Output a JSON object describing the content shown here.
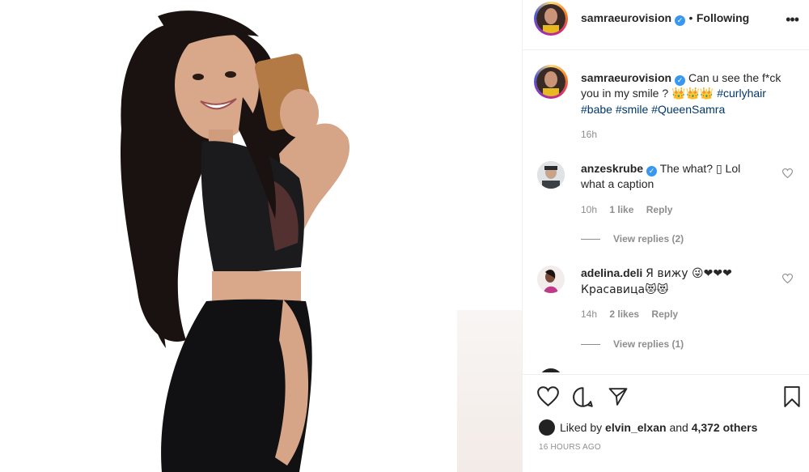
{
  "post": {
    "username": "samraeurovision",
    "verified_mark": "✓",
    "separator": "•",
    "follow_status": "Following",
    "more_icon": "•••"
  },
  "caption": {
    "username": "samraeurovision",
    "text": "Can u see the f*ck you in my smile ? ",
    "crowns": "👑👑👑",
    "hashtags": [
      "#curlyhair",
      "#babe",
      "#smile",
      "#QueenSamra"
    ],
    "time": "16h"
  },
  "comments": [
    {
      "username": "anzeskrube",
      "verified": true,
      "text_line1": "The what? ▯ Lol",
      "text_line2": "what a caption",
      "time": "10h",
      "likes": "1 like",
      "reply": "Reply",
      "view_replies": "View replies (2)"
    },
    {
      "username": "adelina.deli",
      "verified": false,
      "text_line1": "Я вижу 😜❤❤❤",
      "text_line2": "Красавица😻😻",
      "time": "14h",
      "likes": "2 likes",
      "reply": "Reply",
      "view_replies": "View replies (1)"
    }
  ],
  "likes": {
    "prefix": "Liked by",
    "user": "elvin_elxan",
    "and": "and",
    "count": "4,372 others"
  },
  "timestamp": "16 HOURS AGO",
  "icons": [
    "heart-icon",
    "comment-icon",
    "share-icon",
    "bookmark-icon",
    "more-icon",
    "verified-icon"
  ],
  "colors": {
    "link": "#00376b",
    "verified": "#3897f0",
    "muted": "#8e8e8e",
    "text": "#262626"
  }
}
